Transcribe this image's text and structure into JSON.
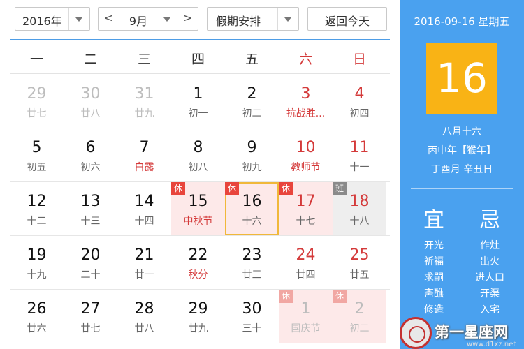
{
  "toolbar": {
    "year": "2016年",
    "month": "9月",
    "prev_label": "<",
    "next_label": ">",
    "holiday_label": "假期安排",
    "today_label": "返回今天"
  },
  "weekdays": [
    "一",
    "二",
    "三",
    "四",
    "五",
    "六",
    "日"
  ],
  "weeks": [
    [
      {
        "num": "29",
        "sub": "廿七",
        "other": true
      },
      {
        "num": "30",
        "sub": "廿八",
        "other": true
      },
      {
        "num": "31",
        "sub": "廿九",
        "other": true
      },
      {
        "num": "1",
        "sub": "初一"
      },
      {
        "num": "2",
        "sub": "初二"
      },
      {
        "num": "3",
        "sub": "抗战胜...",
        "weekend": true,
        "festival": true
      },
      {
        "num": "4",
        "sub": "初四",
        "weekend": true
      }
    ],
    [
      {
        "num": "5",
        "sub": "初五"
      },
      {
        "num": "6",
        "sub": "初六"
      },
      {
        "num": "7",
        "sub": "白露",
        "festival": true
      },
      {
        "num": "8",
        "sub": "初八"
      },
      {
        "num": "9",
        "sub": "初九"
      },
      {
        "num": "10",
        "sub": "教师节",
        "weekend": true,
        "festival": true
      },
      {
        "num": "11",
        "sub": "十一",
        "weekend": true
      }
    ],
    [
      {
        "num": "12",
        "sub": "十二"
      },
      {
        "num": "13",
        "sub": "十三"
      },
      {
        "num": "14",
        "sub": "十四"
      },
      {
        "num": "15",
        "sub": "中秋节",
        "festival": true,
        "holiday": true,
        "badge": "休"
      },
      {
        "num": "16",
        "sub": "十六",
        "holiday": true,
        "badge": "休",
        "selected": true
      },
      {
        "num": "17",
        "sub": "十七",
        "weekend": true,
        "holiday": true,
        "badge": "休"
      },
      {
        "num": "18",
        "sub": "十八",
        "weekend": true,
        "workday": true,
        "badge": "班"
      }
    ],
    [
      {
        "num": "19",
        "sub": "十九"
      },
      {
        "num": "20",
        "sub": "二十"
      },
      {
        "num": "21",
        "sub": "廿一"
      },
      {
        "num": "22",
        "sub": "秋分",
        "festival": true
      },
      {
        "num": "23",
        "sub": "廿三"
      },
      {
        "num": "24",
        "sub": "廿四",
        "weekend": true
      },
      {
        "num": "25",
        "sub": "廿五",
        "weekend": true
      }
    ],
    [
      {
        "num": "26",
        "sub": "廿六"
      },
      {
        "num": "27",
        "sub": "廿七"
      },
      {
        "num": "28",
        "sub": "廿八"
      },
      {
        "num": "29",
        "sub": "廿九"
      },
      {
        "num": "30",
        "sub": "三十"
      },
      {
        "num": "1",
        "sub": "国庆节",
        "other": true,
        "holiday": true,
        "badge": "休"
      },
      {
        "num": "2",
        "sub": "初二",
        "other": true,
        "holiday": true,
        "badge": "休"
      }
    ]
  ],
  "side": {
    "date_line": "2016-09-16 星期五",
    "big_day": "16",
    "lunar_date": "八月十六",
    "ganzhi_year": "丙申年【猴年】",
    "ganzhi_day": "丁酉月 辛丑日",
    "yi_title": "宜",
    "ji_title": "忌",
    "yi_items": [
      "开光",
      "祈福",
      "求嗣",
      "斋醮",
      "修造"
    ],
    "ji_items": [
      "作灶",
      "出火",
      "进人口",
      "开渠",
      "入宅"
    ]
  },
  "watermark": {
    "text": "第一星座网",
    "url": "www.d1xz.net"
  },
  "colors": {
    "accent_blue": "#4aa1ef",
    "today_orange": "#f9b315",
    "holiday_red": "#d43a3a",
    "badge_red": "#e8453c",
    "holiday_bg": "#fde9e9",
    "selected_border": "#f0b83a"
  }
}
